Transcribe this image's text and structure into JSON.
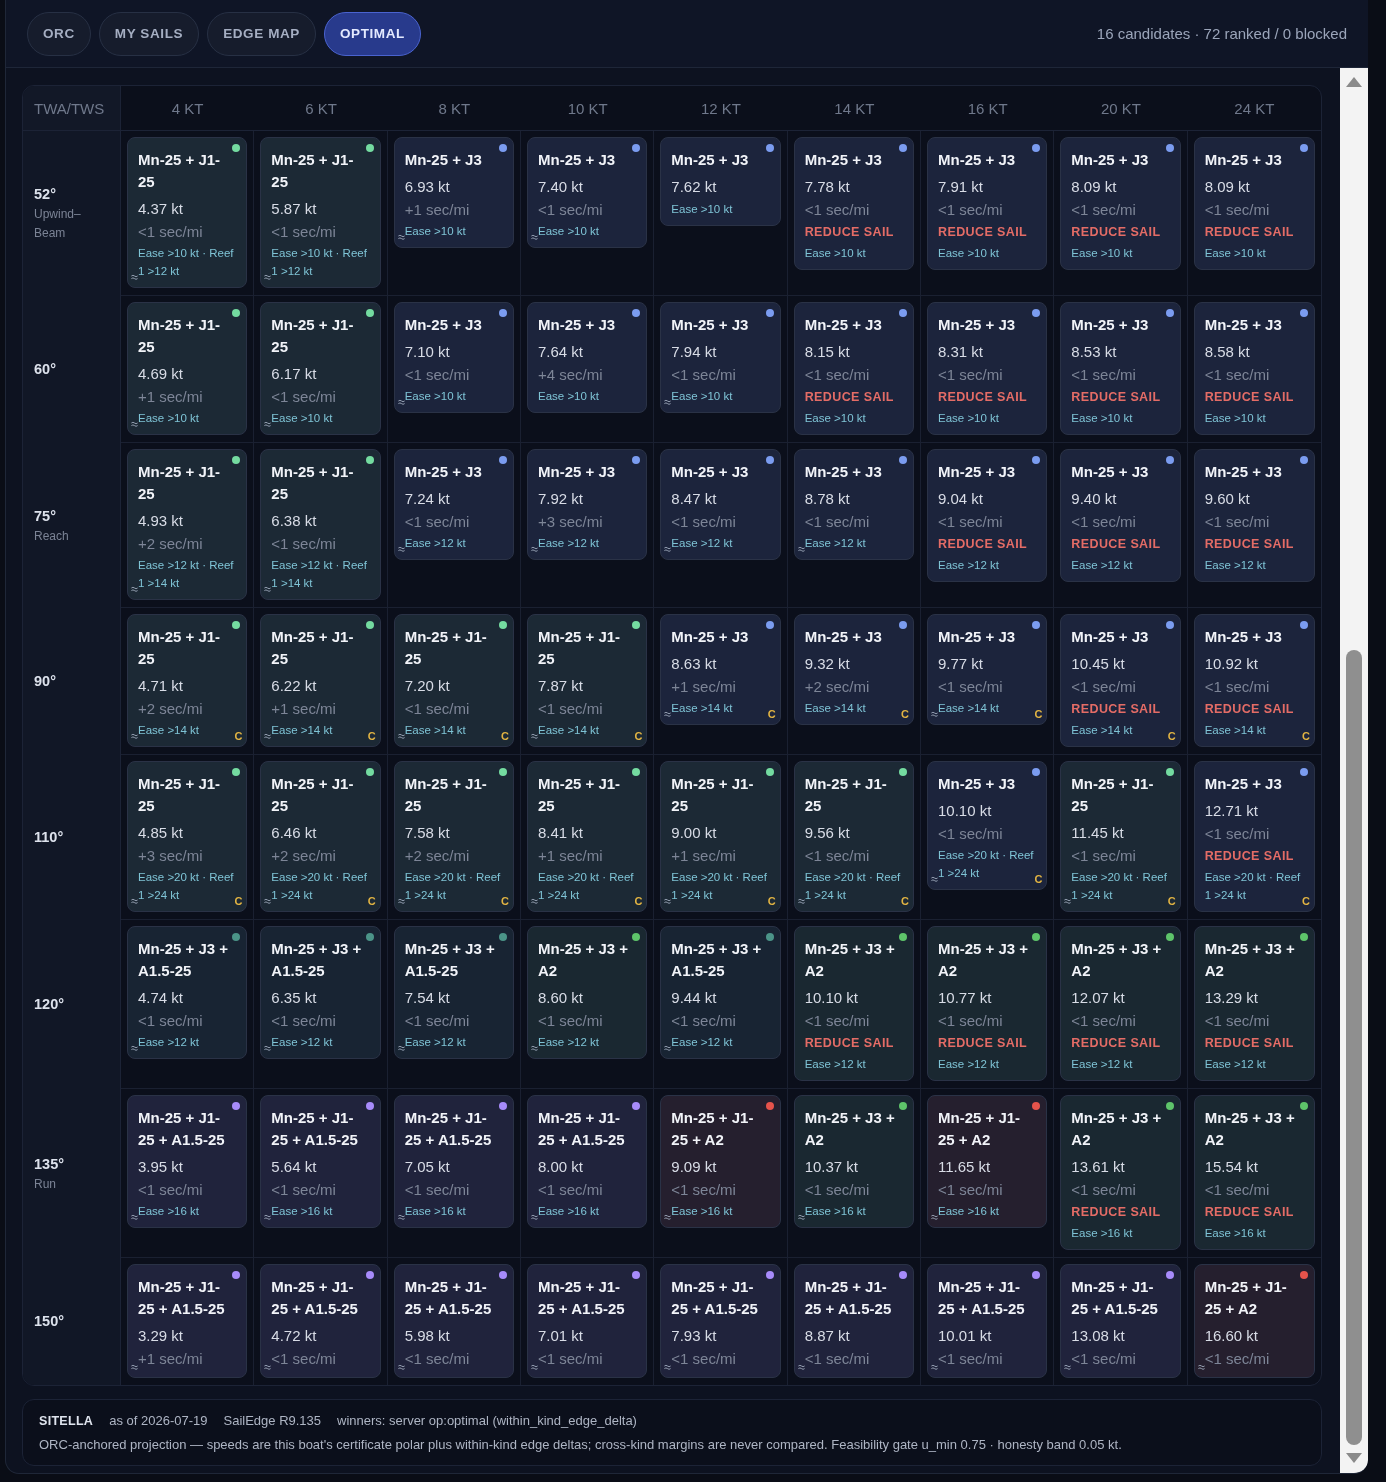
{
  "tabs": [
    {
      "label": "ORC",
      "selected": false
    },
    {
      "label": "MY SAILS",
      "selected": false
    },
    {
      "label": "EDGE MAP",
      "selected": false
    },
    {
      "label": "OPTIMAL",
      "selected": true
    }
  ],
  "summary": "16 candidates · 72 ranked / 0 blocked",
  "grid": {
    "corner": "TWA/TWS",
    "columns": [
      "4 KT",
      "6 KT",
      "8 KT",
      "10 KT",
      "12 KT",
      "14 KT",
      "16 KT",
      "20 KT",
      "24 KT"
    ],
    "rows": [
      {
        "angle": "52°",
        "note": "Upwind–Beam",
        "cells": [
          {
            "sails": "Mn-25 + J1-25",
            "color": "#74dba0",
            "speed": "4.37 kt",
            "delta": "<1 sec/mi",
            "advice": "Ease >10 kt · Reef 1 >12 kt",
            "approx": true
          },
          {
            "sails": "Mn-25 + J1-25",
            "color": "#74dba0",
            "speed": "5.87 kt",
            "delta": "<1 sec/mi",
            "advice": "Ease >10 kt · Reef 1 >12 kt",
            "approx": true
          },
          {
            "sails": "Mn-25 + J3",
            "color": "#7b9cf0",
            "speed": "6.93 kt",
            "delta": "+1 sec/mi",
            "advice": "Ease >10 kt",
            "approx": true
          },
          {
            "sails": "Mn-25 + J3",
            "color": "#7b9cf0",
            "speed": "7.40 kt",
            "delta": "<1 sec/mi",
            "advice": "Ease >10 kt",
            "approx": true
          },
          {
            "sails": "Mn-25 + J3",
            "color": "#7b9cf0",
            "speed": "7.62 kt",
            "advice": "Ease >10 kt",
            "approx": false
          },
          {
            "sails": "Mn-25 + J3",
            "color": "#7b9cf0",
            "speed": "7.78 kt",
            "delta": "<1 sec/mi",
            "warning": "REDUCE SAIL",
            "advice": "Ease >10 kt",
            "approx": false
          },
          {
            "sails": "Mn-25 + J3",
            "color": "#7b9cf0",
            "speed": "7.91 kt",
            "delta": "<1 sec/mi",
            "warning": "REDUCE SAIL",
            "advice": "Ease >10 kt",
            "approx": false
          },
          {
            "sails": "Mn-25 + J3",
            "color": "#7b9cf0",
            "speed": "8.09 kt",
            "delta": "<1 sec/mi",
            "warning": "REDUCE SAIL",
            "advice": "Ease >10 kt",
            "approx": false
          },
          {
            "sails": "Mn-25 + J3",
            "color": "#7b9cf0",
            "speed": "8.09 kt",
            "delta": "<1 sec/mi",
            "warning": "REDUCE SAIL",
            "advice": "Ease >10 kt",
            "approx": false
          }
        ]
      },
      {
        "angle": "60°",
        "cells": [
          {
            "sails": "Mn-25 + J1-25",
            "color": "#74dba0",
            "speed": "4.69 kt",
            "delta": "+1 sec/mi",
            "advice": "Ease >10 kt",
            "approx": true
          },
          {
            "sails": "Mn-25 + J1-25",
            "color": "#74dba0",
            "speed": "6.17 kt",
            "delta": "<1 sec/mi",
            "advice": "Ease >10 kt",
            "approx": true
          },
          {
            "sails": "Mn-25 + J3",
            "color": "#7b9cf0",
            "speed": "7.10 kt",
            "delta": "<1 sec/mi",
            "advice": "Ease >10 kt",
            "approx": true
          },
          {
            "sails": "Mn-25 + J3",
            "color": "#7b9cf0",
            "speed": "7.64 kt",
            "delta": "+4 sec/mi",
            "advice": "Ease >10 kt",
            "approx": false
          },
          {
            "sails": "Mn-25 + J3",
            "color": "#7b9cf0",
            "speed": "7.94 kt",
            "delta": "<1 sec/mi",
            "advice": "Ease >10 kt",
            "approx": true
          },
          {
            "sails": "Mn-25 + J3",
            "color": "#7b9cf0",
            "speed": "8.15 kt",
            "delta": "<1 sec/mi",
            "warning": "REDUCE SAIL",
            "advice": "Ease >10 kt",
            "approx": false
          },
          {
            "sails": "Mn-25 + J3",
            "color": "#7b9cf0",
            "speed": "8.31 kt",
            "delta": "<1 sec/mi",
            "warning": "REDUCE SAIL",
            "advice": "Ease >10 kt",
            "approx": false
          },
          {
            "sails": "Mn-25 + J3",
            "color": "#7b9cf0",
            "speed": "8.53 kt",
            "delta": "<1 sec/mi",
            "warning": "REDUCE SAIL",
            "advice": "Ease >10 kt",
            "approx": false
          },
          {
            "sails": "Mn-25 + J3",
            "color": "#7b9cf0",
            "speed": "8.58 kt",
            "delta": "<1 sec/mi",
            "warning": "REDUCE SAIL",
            "advice": "Ease >10 kt",
            "approx": false
          }
        ]
      },
      {
        "angle": "75°",
        "note": "Reach",
        "cells": [
          {
            "sails": "Mn-25 + J1-25",
            "color": "#74dba0",
            "speed": "4.93 kt",
            "delta": "+2 sec/mi",
            "advice": "Ease >12 kt · Reef 1 >14 kt",
            "approx": true
          },
          {
            "sails": "Mn-25 + J1-25",
            "color": "#74dba0",
            "speed": "6.38 kt",
            "delta": "<1 sec/mi",
            "advice": "Ease >12 kt · Reef 1 >14 kt",
            "approx": true
          },
          {
            "sails": "Mn-25 + J3",
            "color": "#7b9cf0",
            "speed": "7.24 kt",
            "delta": "<1 sec/mi",
            "advice": "Ease >12 kt",
            "approx": true
          },
          {
            "sails": "Mn-25 + J3",
            "color": "#7b9cf0",
            "speed": "7.92 kt",
            "delta": "+3 sec/mi",
            "advice": "Ease >12 kt",
            "approx": true
          },
          {
            "sails": "Mn-25 + J3",
            "color": "#7b9cf0",
            "speed": "8.47 kt",
            "delta": "<1 sec/mi",
            "advice": "Ease >12 kt",
            "approx": true
          },
          {
            "sails": "Mn-25 + J3",
            "color": "#7b9cf0",
            "speed": "8.78 kt",
            "delta": "<1 sec/mi",
            "advice": "Ease >12 kt",
            "approx": true
          },
          {
            "sails": "Mn-25 + J3",
            "color": "#7b9cf0",
            "speed": "9.04 kt",
            "delta": "<1 sec/mi",
            "warning": "REDUCE SAIL",
            "advice": "Ease >12 kt",
            "approx": false
          },
          {
            "sails": "Mn-25 + J3",
            "color": "#7b9cf0",
            "speed": "9.40 kt",
            "delta": "<1 sec/mi",
            "warning": "REDUCE SAIL",
            "advice": "Ease >12 kt",
            "approx": false
          },
          {
            "sails": "Mn-25 + J3",
            "color": "#7b9cf0",
            "speed": "9.60 kt",
            "delta": "<1 sec/mi",
            "warning": "REDUCE SAIL",
            "advice": "Ease >12 kt",
            "approx": false
          }
        ]
      },
      {
        "angle": "90°",
        "cells": [
          {
            "sails": "Mn-25 + J1-25",
            "color": "#74dba0",
            "speed": "4.71 kt",
            "delta": "+2 sec/mi",
            "advice": "Ease >14 kt",
            "approx": true,
            "badge": "C"
          },
          {
            "sails": "Mn-25 + J1-25",
            "color": "#74dba0",
            "speed": "6.22 kt",
            "delta": "+1 sec/mi",
            "advice": "Ease >14 kt",
            "approx": true,
            "badge": "C"
          },
          {
            "sails": "Mn-25 + J1-25",
            "color": "#74dba0",
            "speed": "7.20 kt",
            "delta": "<1 sec/mi",
            "advice": "Ease >14 kt",
            "approx": true,
            "badge": "C"
          },
          {
            "sails": "Mn-25 + J1-25",
            "color": "#74dba0",
            "speed": "7.87 kt",
            "delta": "<1 sec/mi",
            "advice": "Ease >14 kt",
            "approx": true,
            "badge": "C"
          },
          {
            "sails": "Mn-25 + J3",
            "color": "#7b9cf0",
            "speed": "8.63 kt",
            "delta": "+1 sec/mi",
            "advice": "Ease >14 kt",
            "approx": true,
            "badge": "C"
          },
          {
            "sails": "Mn-25 + J3",
            "color": "#7b9cf0",
            "speed": "9.32 kt",
            "delta": "+2 sec/mi",
            "advice": "Ease >14 kt",
            "approx": false,
            "badge": "C"
          },
          {
            "sails": "Mn-25 + J3",
            "color": "#7b9cf0",
            "speed": "9.77 kt",
            "delta": "<1 sec/mi",
            "advice": "Ease >14 kt",
            "approx": true,
            "badge": "C"
          },
          {
            "sails": "Mn-25 + J3",
            "color": "#7b9cf0",
            "speed": "10.45 kt",
            "delta": "<1 sec/mi",
            "warning": "REDUCE SAIL",
            "advice": "Ease >14 kt",
            "approx": false,
            "badge": "C"
          },
          {
            "sails": "Mn-25 + J3",
            "color": "#7b9cf0",
            "speed": "10.92 kt",
            "delta": "<1 sec/mi",
            "warning": "REDUCE SAIL",
            "advice": "Ease >14 kt",
            "approx": false,
            "badge": "C"
          }
        ]
      },
      {
        "angle": "110°",
        "cells": [
          {
            "sails": "Mn-25 + J1-25",
            "color": "#74dba0",
            "speed": "4.85 kt",
            "delta": "+3 sec/mi",
            "advice": "Ease >20 kt · Reef 1 >24 kt",
            "approx": true,
            "badge": "C"
          },
          {
            "sails": "Mn-25 + J1-25",
            "color": "#74dba0",
            "speed": "6.46 kt",
            "delta": "+2 sec/mi",
            "advice": "Ease >20 kt · Reef 1 >24 kt",
            "approx": true,
            "badge": "C"
          },
          {
            "sails": "Mn-25 + J1-25",
            "color": "#74dba0",
            "speed": "7.58 kt",
            "delta": "+2 sec/mi",
            "advice": "Ease >20 kt · Reef 1 >24 kt",
            "approx": true,
            "badge": "C"
          },
          {
            "sails": "Mn-25 + J1-25",
            "color": "#74dba0",
            "speed": "8.41 kt",
            "delta": "+1 sec/mi",
            "advice": "Ease >20 kt · Reef 1 >24 kt",
            "approx": true,
            "badge": "C"
          },
          {
            "sails": "Mn-25 + J1-25",
            "color": "#74dba0",
            "speed": "9.00 kt",
            "delta": "+1 sec/mi",
            "advice": "Ease >20 kt · Reef 1 >24 kt",
            "approx": true,
            "badge": "C"
          },
          {
            "sails": "Mn-25 + J1-25",
            "color": "#74dba0",
            "speed": "9.56 kt",
            "delta": "<1 sec/mi",
            "advice": "Ease >20 kt · Reef 1 >24 kt",
            "approx": true,
            "badge": "C"
          },
          {
            "sails": "Mn-25 + J3",
            "color": "#7b9cf0",
            "speed": "10.10 kt",
            "delta": "<1 sec/mi",
            "advice": "Ease >20 kt · Reef 1 >24 kt",
            "approx": true,
            "badge": "C"
          },
          {
            "sails": "Mn-25 + J1-25",
            "color": "#74dba0",
            "speed": "11.45 kt",
            "delta": "<1 sec/mi",
            "advice": "Ease >20 kt · Reef 1 >24 kt",
            "approx": true,
            "badge": "C"
          },
          {
            "sails": "Mn-25 + J3",
            "color": "#7b9cf0",
            "speed": "12.71 kt",
            "delta": "<1 sec/mi",
            "warning": "REDUCE SAIL",
            "advice": "Ease >20 kt · Reef 1 >24 kt",
            "approx": false,
            "badge": "C"
          }
        ]
      },
      {
        "angle": "120°",
        "cells": [
          {
            "sails": "Mn-25 + J3 + A1.5-25",
            "color": "#4b9488",
            "speed": "4.74 kt",
            "delta": "<1 sec/mi",
            "advice": "Ease >12 kt",
            "approx": true
          },
          {
            "sails": "Mn-25 + J3 + A1.5-25",
            "color": "#4b9488",
            "speed": "6.35 kt",
            "delta": "<1 sec/mi",
            "advice": "Ease >12 kt",
            "approx": true
          },
          {
            "sails": "Mn-25 + J3 + A1.5-25",
            "color": "#4b9488",
            "speed": "7.54 kt",
            "delta": "<1 sec/mi",
            "advice": "Ease >12 kt",
            "approx": true
          },
          {
            "sails": "Mn-25 + J3 + A2",
            "color": "#5ec46a",
            "speed": "8.60 kt",
            "delta": "<1 sec/mi",
            "advice": "Ease >12 kt",
            "approx": true
          },
          {
            "sails": "Mn-25 + J3 + A1.5-25",
            "color": "#4b9488",
            "speed": "9.44 kt",
            "delta": "<1 sec/mi",
            "advice": "Ease >12 kt",
            "approx": true
          },
          {
            "sails": "Mn-25 + J3 + A2",
            "color": "#5ec46a",
            "speed": "10.10 kt",
            "delta": "<1 sec/mi",
            "warning": "REDUCE SAIL",
            "advice": "Ease >12 kt",
            "approx": false
          },
          {
            "sails": "Mn-25 + J3 + A2",
            "color": "#5ec46a",
            "speed": "10.77 kt",
            "delta": "<1 sec/mi",
            "warning": "REDUCE SAIL",
            "advice": "Ease >12 kt",
            "approx": false
          },
          {
            "sails": "Mn-25 + J3 + A2",
            "color": "#5ec46a",
            "speed": "12.07 kt",
            "delta": "<1 sec/mi",
            "warning": "REDUCE SAIL",
            "advice": "Ease >12 kt",
            "approx": false
          },
          {
            "sails": "Mn-25 + J3 + A2",
            "color": "#5ec46a",
            "speed": "13.29 kt",
            "delta": "<1 sec/mi",
            "warning": "REDUCE SAIL",
            "advice": "Ease >12 kt",
            "approx": false
          }
        ]
      },
      {
        "angle": "135°",
        "note": "Run",
        "cells": [
          {
            "sails": "Mn-25 + J1-25 + A1.5-25",
            "color": "#a78bfa",
            "speed": "3.95 kt",
            "delta": "<1 sec/mi",
            "advice": "Ease >16 kt",
            "approx": true
          },
          {
            "sails": "Mn-25 + J1-25 + A1.5-25",
            "color": "#a78bfa",
            "speed": "5.64 kt",
            "delta": "<1 sec/mi",
            "advice": "Ease >16 kt",
            "approx": true
          },
          {
            "sails": "Mn-25 + J1-25 + A1.5-25",
            "color": "#a78bfa",
            "speed": "7.05 kt",
            "delta": "<1 sec/mi",
            "advice": "Ease >16 kt",
            "approx": true
          },
          {
            "sails": "Mn-25 + J1-25 + A1.5-25",
            "color": "#a78bfa",
            "speed": "8.00 kt",
            "delta": "<1 sec/mi",
            "advice": "Ease >16 kt",
            "approx": true
          },
          {
            "sails": "Mn-25 + J1-25 + A2",
            "color": "#e5534b",
            "speed": "9.09 kt",
            "delta": "<1 sec/mi",
            "advice": "Ease >16 kt",
            "approx": true
          },
          {
            "sails": "Mn-25 + J3 + A2",
            "color": "#5ec46a",
            "speed": "10.37 kt",
            "delta": "<1 sec/mi",
            "advice": "Ease >16 kt",
            "approx": true
          },
          {
            "sails": "Mn-25 + J1-25 + A2",
            "color": "#e5534b",
            "speed": "11.65 kt",
            "delta": "<1 sec/mi",
            "advice": "Ease >16 kt",
            "approx": true
          },
          {
            "sails": "Mn-25 + J3 + A2",
            "color": "#5ec46a",
            "speed": "13.61 kt",
            "delta": "<1 sec/mi",
            "warning": "REDUCE SAIL",
            "advice": "Ease >16 kt",
            "approx": false
          },
          {
            "sails": "Mn-25 + J3 + A2",
            "color": "#5ec46a",
            "speed": "15.54 kt",
            "delta": "<1 sec/mi",
            "warning": "REDUCE SAIL",
            "advice": "Ease >16 kt",
            "approx": false
          }
        ]
      },
      {
        "angle": "150°",
        "cells": [
          {
            "sails": "Mn-25 + J1-25 + A1.5-25",
            "color": "#a78bfa",
            "speed": "3.29 kt",
            "delta": "+1 sec/mi",
            "approx": true
          },
          {
            "sails": "Mn-25 + J1-25 + A1.5-25",
            "color": "#a78bfa",
            "speed": "4.72 kt",
            "delta": "<1 sec/mi",
            "approx": true
          },
          {
            "sails": "Mn-25 + J1-25 + A1.5-25",
            "color": "#a78bfa",
            "speed": "5.98 kt",
            "delta": "<1 sec/mi",
            "approx": true
          },
          {
            "sails": "Mn-25 + J1-25 + A1.5-25",
            "color": "#a78bfa",
            "speed": "7.01 kt",
            "delta": "<1 sec/mi",
            "approx": true
          },
          {
            "sails": "Mn-25 + J1-25 + A1.5-25",
            "color": "#a78bfa",
            "speed": "7.93 kt",
            "delta": "<1 sec/mi",
            "approx": true
          },
          {
            "sails": "Mn-25 + J1-25 + A1.5-25",
            "color": "#a78bfa",
            "speed": "8.87 kt",
            "delta": "<1 sec/mi",
            "approx": true
          },
          {
            "sails": "Mn-25 + J1-25 + A1.5-25",
            "color": "#a78bfa",
            "speed": "10.01 kt",
            "delta": "<1 sec/mi",
            "approx": true
          },
          {
            "sails": "Mn-25 + J1-25 + A1.5-25",
            "color": "#a78bfa",
            "speed": "13.08 kt",
            "delta": "<1 sec/mi",
            "approx": true
          },
          {
            "sails": "Mn-25 + J1-25 + A2",
            "color": "#e5534b",
            "speed": "16.60 kt",
            "delta": "<1 sec/mi",
            "approx": true
          }
        ]
      }
    ]
  },
  "footer": {
    "boat": "SITELLA",
    "meta": [
      "as of 2026-07-19",
      "SailEdge R9.135",
      "winners: server op:optimal (within_kind_edge_delta)"
    ],
    "note": "ORC-anchored projection — speeds are this boat's certificate polar plus within-kind edge deltas; cross-kind margins are never compared. Feasibility gate u_min 0.75 · honesty band 0.05 kt."
  }
}
